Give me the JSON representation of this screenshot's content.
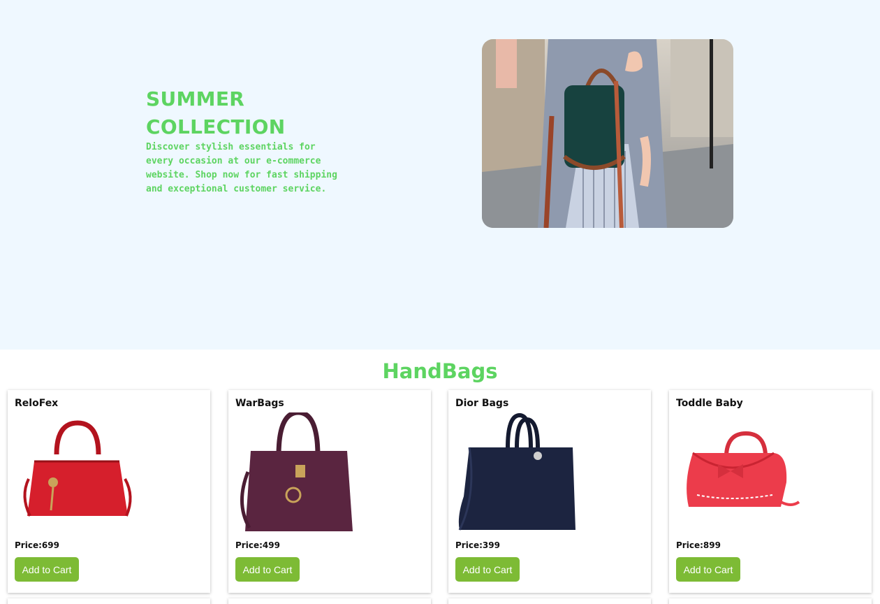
{
  "hero": {
    "title": "SUMMER COLLECTION",
    "description": "Discover stylish essentials for every occasion at our e-commerce website. Shop now for fast shipping and exceptional customer service."
  },
  "section": {
    "title": "HandBags"
  },
  "products": [
    {
      "name": "ReloFex",
      "price": "Price:699",
      "button": "Add to Cart",
      "color": "#d61f2c"
    },
    {
      "name": "WarBags",
      "price": "Price:499",
      "button": "Add to Cart",
      "color": "#5a2540"
    },
    {
      "name": "Dior Bags",
      "price": "Price:399",
      "button": "Add to Cart",
      "color": "#1c2440"
    },
    {
      "name": "Toddle Baby",
      "price": "Price:899",
      "button": "Add to Cart",
      "color": "#ec3c4b"
    }
  ],
  "colors": {
    "accent": "#5dd461",
    "button": "#7dbb35",
    "hero_bg": "#eff8ff"
  }
}
